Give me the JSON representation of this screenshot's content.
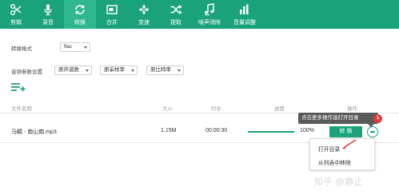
{
  "toolbar": {
    "items": [
      {
        "label": "剪辑",
        "icon": "scissors-icon",
        "active": false
      },
      {
        "label": "录音",
        "icon": "microphone-icon",
        "active": false
      },
      {
        "label": "转换",
        "icon": "convert-icon",
        "active": true
      },
      {
        "label": "合并",
        "icon": "merge-icon",
        "active": false
      },
      {
        "label": "变速",
        "icon": "speed-icon",
        "active": false
      },
      {
        "label": "提取",
        "icon": "extract-icon",
        "active": false
      },
      {
        "label": "噪声消除",
        "icon": "noise-reduction-icon",
        "active": false
      },
      {
        "label": "音量调整",
        "icon": "volume-bars-icon",
        "active": false
      }
    ]
  },
  "settings": {
    "format_label": "转换格式",
    "format_value": "flac",
    "audio_params_label": "音频参数设置",
    "channels_value": "原声道数",
    "sample_rate_value": "原采样率",
    "bitrate_value": "原比特率"
  },
  "table": {
    "headers": {
      "name": "文件名称",
      "size": "大小",
      "duration": "时长",
      "progress": "进度",
      "action": "操作"
    },
    "rows": [
      {
        "name": "马頔 - 南山南.mp3",
        "size": "1.15M",
        "duration": "00:00:30",
        "progress_percent": 100,
        "progress_text": "100%",
        "convert_label": "转 换"
      }
    ]
  },
  "tooltip": {
    "text": "点击更多操作选打开目录",
    "badge": "1"
  },
  "context_menu": {
    "items": [
      "打开目录",
      "从列表中移除"
    ]
  },
  "watermark": {
    "text": "知乎 @静止"
  },
  "colors": {
    "accent": "#1aa37a",
    "toolbar_active": "#2fb88e",
    "badge": "#e4393c",
    "pointer": "#e4393c",
    "tooltip_bg": "#5a5a5a"
  }
}
